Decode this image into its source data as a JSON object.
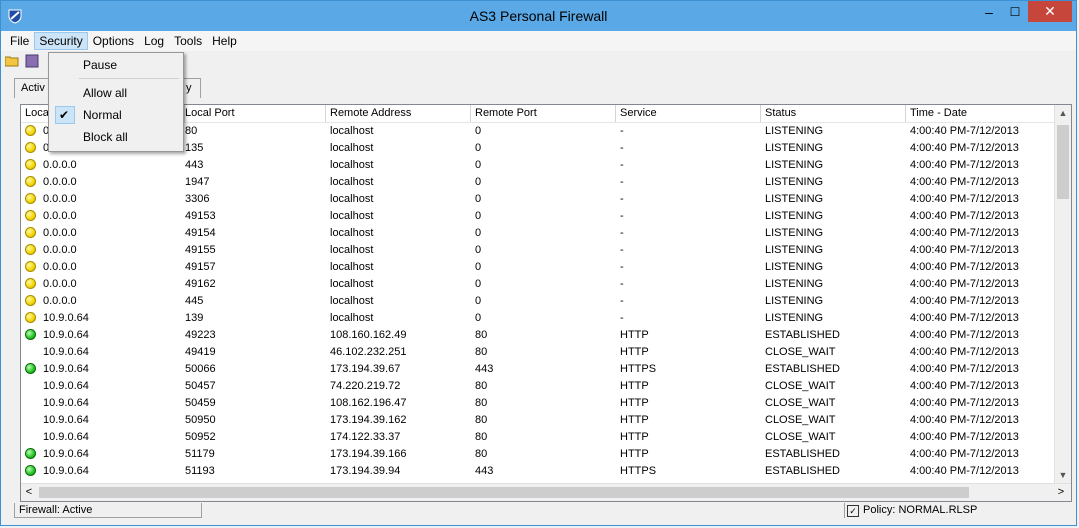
{
  "window": {
    "title": "AS3 Personal Firewall",
    "minimize_glyph": "–",
    "maximize_glyph": "☐",
    "close_glyph": "✕"
  },
  "menubar": {
    "items": [
      "File",
      "Security",
      "Options",
      "Log",
      "Tools",
      "Help"
    ],
    "active": "Security"
  },
  "security_menu": {
    "items": [
      {
        "label": "Pause",
        "checked": false
      },
      {
        "label": "Allow all",
        "checked": false
      },
      {
        "label": "Normal",
        "checked": true
      },
      {
        "label": "Block all",
        "checked": false
      }
    ]
  },
  "tabs": {
    "left_label": "Activ",
    "right_label": "y"
  },
  "table": {
    "columns": [
      "Loca",
      "Local Port",
      "Remote Address",
      "Remote Port",
      "Service",
      "Status",
      "Time - Date"
    ],
    "rows": [
      {
        "icon": "yellow",
        "local": "0",
        "port": "80",
        "remote": "localhost",
        "rport": "0",
        "service": "-",
        "status": "LISTENING",
        "time": "4:00:40 PM-7/12/2013"
      },
      {
        "icon": "yellow",
        "local": "0.0.0.0",
        "port": "135",
        "remote": "localhost",
        "rport": "0",
        "service": "-",
        "status": "LISTENING",
        "time": "4:00:40 PM-7/12/2013"
      },
      {
        "icon": "yellow",
        "local": "0.0.0.0",
        "port": "443",
        "remote": "localhost",
        "rport": "0",
        "service": "-",
        "status": "LISTENING",
        "time": "4:00:40 PM-7/12/2013"
      },
      {
        "icon": "yellow",
        "local": "0.0.0.0",
        "port": "1947",
        "remote": "localhost",
        "rport": "0",
        "service": "-",
        "status": "LISTENING",
        "time": "4:00:40 PM-7/12/2013"
      },
      {
        "icon": "yellow",
        "local": "0.0.0.0",
        "port": "3306",
        "remote": "localhost",
        "rport": "0",
        "service": "-",
        "status": "LISTENING",
        "time": "4:00:40 PM-7/12/2013"
      },
      {
        "icon": "yellow",
        "local": "0.0.0.0",
        "port": "49153",
        "remote": "localhost",
        "rport": "0",
        "service": "-",
        "status": "LISTENING",
        "time": "4:00:40 PM-7/12/2013"
      },
      {
        "icon": "yellow",
        "local": "0.0.0.0",
        "port": "49154",
        "remote": "localhost",
        "rport": "0",
        "service": "-",
        "status": "LISTENING",
        "time": "4:00:40 PM-7/12/2013"
      },
      {
        "icon": "yellow",
        "local": "0.0.0.0",
        "port": "49155",
        "remote": "localhost",
        "rport": "0",
        "service": "-",
        "status": "LISTENING",
        "time": "4:00:40 PM-7/12/2013"
      },
      {
        "icon": "yellow",
        "local": "0.0.0.0",
        "port": "49157",
        "remote": "localhost",
        "rport": "0",
        "service": "-",
        "status": "LISTENING",
        "time": "4:00:40 PM-7/12/2013"
      },
      {
        "icon": "yellow",
        "local": "0.0.0.0",
        "port": "49162",
        "remote": "localhost",
        "rport": "0",
        "service": "-",
        "status": "LISTENING",
        "time": "4:00:40 PM-7/12/2013"
      },
      {
        "icon": "yellow",
        "local": "0.0.0.0",
        "port": "445",
        "remote": "localhost",
        "rport": "0",
        "service": "-",
        "status": "LISTENING",
        "time": "4:00:40 PM-7/12/2013"
      },
      {
        "icon": "yellow",
        "local": "10.9.0.64",
        "port": "139",
        "remote": "localhost",
        "rport": "0",
        "service": "-",
        "status": "LISTENING",
        "time": "4:00:40 PM-7/12/2013"
      },
      {
        "icon": "green",
        "local": "10.9.0.64",
        "port": "49223",
        "remote": "108.160.162.49",
        "rport": "80",
        "service": "HTTP",
        "status": "ESTABLISHED",
        "time": "4:00:40 PM-7/12/2013"
      },
      {
        "icon": "none",
        "local": "10.9.0.64",
        "port": "49419",
        "remote": "46.102.232.251",
        "rport": "80",
        "service": "HTTP",
        "status": "CLOSE_WAIT",
        "time": "4:00:40 PM-7/12/2013"
      },
      {
        "icon": "green",
        "local": "10.9.0.64",
        "port": "50066",
        "remote": "173.194.39.67",
        "rport": "443",
        "service": "HTTPS",
        "status": "ESTABLISHED",
        "time": "4:00:40 PM-7/12/2013"
      },
      {
        "icon": "none",
        "local": "10.9.0.64",
        "port": "50457",
        "remote": "74.220.219.72",
        "rport": "80",
        "service": "HTTP",
        "status": "CLOSE_WAIT",
        "time": "4:00:40 PM-7/12/2013"
      },
      {
        "icon": "none",
        "local": "10.9.0.64",
        "port": "50459",
        "remote": "108.162.196.47",
        "rport": "80",
        "service": "HTTP",
        "status": "CLOSE_WAIT",
        "time": "4:00:40 PM-7/12/2013"
      },
      {
        "icon": "none",
        "local": "10.9.0.64",
        "port": "50950",
        "remote": "173.194.39.162",
        "rport": "80",
        "service": "HTTP",
        "status": "CLOSE_WAIT",
        "time": "4:00:40 PM-7/12/2013"
      },
      {
        "icon": "none",
        "local": "10.9.0.64",
        "port": "50952",
        "remote": "174.122.33.37",
        "rport": "80",
        "service": "HTTP",
        "status": "CLOSE_WAIT",
        "time": "4:00:40 PM-7/12/2013"
      },
      {
        "icon": "green",
        "local": "10.9.0.64",
        "port": "51179",
        "remote": "173.194.39.166",
        "rport": "80",
        "service": "HTTP",
        "status": "ESTABLISHED",
        "time": "4:00:40 PM-7/12/2013"
      },
      {
        "icon": "green",
        "local": "10.9.0.64",
        "port": "51193",
        "remote": "173.194.39.94",
        "rport": "443",
        "service": "HTTPS",
        "status": "ESTABLISHED",
        "time": "4:00:40 PM-7/12/2013"
      }
    ]
  },
  "statusbar": {
    "firewall_status": "Firewall: Active",
    "policy": "Policy: NORMAL.RLSP"
  },
  "scroll": {
    "up": "▲",
    "down": "▼",
    "left": "<",
    "right": ">"
  },
  "colors": {
    "titlebar": "#5aa9e6",
    "close": "#c7463b",
    "listening": "#f2d600",
    "established": "#22c322"
  }
}
